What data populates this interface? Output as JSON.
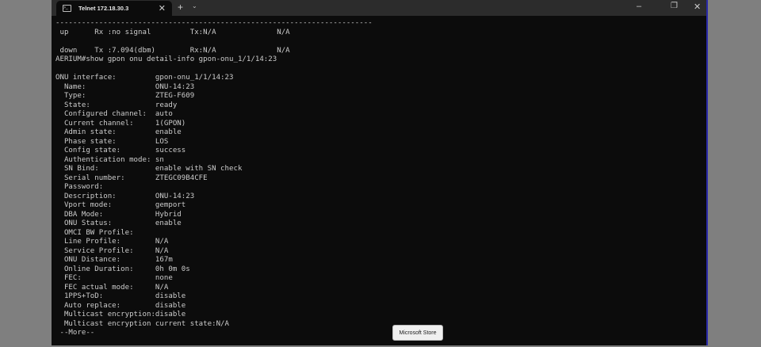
{
  "window": {
    "tab_title": "Telnet 172.18.30.3",
    "tab_icon": "terminal-icon",
    "new_tab_label": "+",
    "tab_menu_label": "⌄",
    "minimize_label": "–",
    "restore_label": "❐",
    "close_label": "✕",
    "tab_close_label": "✕"
  },
  "terminal": {
    "lines": [
      "-------------------------------------------------------------------------",
      " up      Rx :no signal         Tx:N/A              N/A",
      "",
      " down    Tx :7.094(dbm)        Rx:N/A              N/A",
      "AERIUM#show gpon onu detail-info gpon-onu_1/1/14:23",
      "",
      "ONU interface:         gpon-onu_1/1/14:23",
      "  Name:                ONU-14:23",
      "  Type:                ZTEG-F609",
      "  State:               ready",
      "  Configured channel:  auto",
      "  Current channel:     1(GPON)",
      "  Admin state:         enable",
      "  Phase state:         LOS",
      "  Config state:        success",
      "  Authentication mode: sn",
      "  SN Bind:             enable with SN check",
      "  Serial number:       ZTEGC09B4CFE",
      "  Password:",
      "  Description:         ONU-14:23",
      "  Vport mode:          gemport",
      "  DBA Mode:            Hybrid",
      "  ONU Status:          enable",
      "  OMCI BW Profile:",
      "  Line Profile:        N/A",
      "  Service Profile:     N/A",
      "  ONU Distance:        167m",
      "  Online Duration:     0h 0m 0s",
      "  FEC:                 none",
      "  FEC actual mode:     N/A",
      "  1PPS+ToD:            disable",
      "  Auto replace:        disable",
      "  Multicast encryption:disable",
      "  Multicast encryption current state:N/A",
      " --More--"
    ]
  },
  "tooltip": "Microsoft Store"
}
